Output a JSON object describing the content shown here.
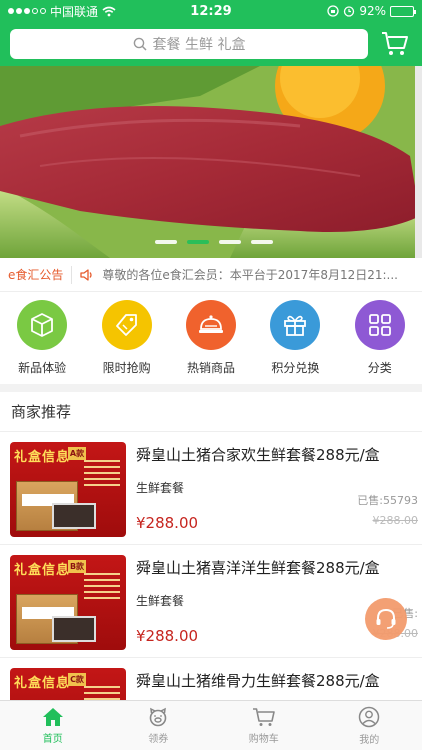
{
  "status": {
    "carrier": "中国联通",
    "time": "12:29",
    "battery": "92%",
    "battery_level": 0.92
  },
  "search": {
    "placeholder": "套餐 生鲜 礼盒"
  },
  "notice": {
    "title": "e食汇公告",
    "text": "尊敬的各位e食汇会员：本平台于2017年8月12日21:..."
  },
  "quick_links": [
    {
      "label": "新品体验",
      "icon": "box-icon",
      "color": "#7ac943"
    },
    {
      "label": "限时抢购",
      "icon": "price-tag-icon",
      "color": "#f5c400"
    },
    {
      "label": "热销商品",
      "icon": "serving-dish-icon",
      "color": "#f0622d"
    },
    {
      "label": "积分兑换",
      "icon": "gift-icon",
      "color": "#3a9ad9"
    },
    {
      "label": "分类",
      "icon": "grid-icon",
      "color": "#8e59d4"
    }
  ],
  "section": {
    "title": "商家推荐"
  },
  "products": [
    {
      "title": "舜皇山土猪合家欢生鲜套餐288元/盒",
      "subtitle": "生鲜套餐",
      "price": "¥288.00",
      "sold": "已售:55793",
      "old_price": "¥288.00",
      "thumb_title": "礼盒信息",
      "thumb_tag": "A款"
    },
    {
      "title": "舜皇山土猪喜洋洋生鲜套餐288元/盒",
      "subtitle": "生鲜套餐",
      "price": "¥288.00",
      "sold": "已售:",
      "old_price": "¥288.00",
      "thumb_title": "礼盒信息",
      "thumb_tag": "B款"
    },
    {
      "title": "舜皇山土猪维骨力生鲜套餐288元/盒",
      "subtitle": "",
      "price": "",
      "sold": "",
      "old_price": "",
      "thumb_title": "礼盒信息",
      "thumb_tag": "C款"
    }
  ],
  "tabs": [
    {
      "label": "首页",
      "icon": "home-icon",
      "active": true
    },
    {
      "label": "领券",
      "icon": "pig-icon",
      "active": false
    },
    {
      "label": "购物车",
      "icon": "cart-icon",
      "active": false
    },
    {
      "label": "我的",
      "icon": "user-icon",
      "active": false
    }
  ],
  "colors": {
    "brand": "#21bf5b",
    "price": "#c6251f",
    "notice": "#e65b2d"
  }
}
